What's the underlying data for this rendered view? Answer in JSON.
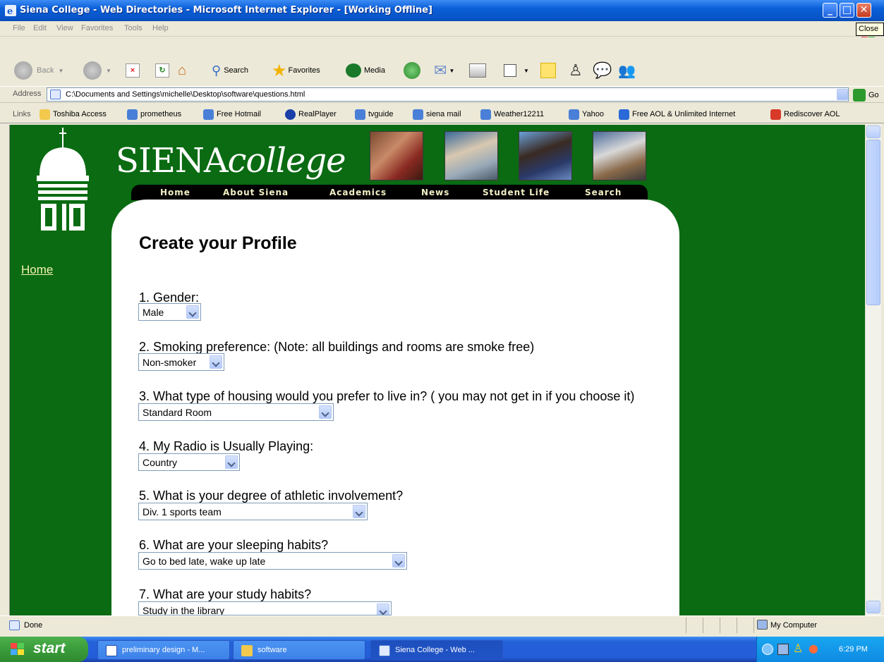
{
  "window": {
    "title": "Siena College - Web Directories - Microsoft Internet Explorer - [Working Offline]",
    "tooltip": "Close"
  },
  "menu": [
    "File",
    "Edit",
    "View",
    "Favorites",
    "Tools",
    "Help"
  ],
  "toolbar": {
    "back": "Back",
    "search": "Search",
    "favorites": "Favorites",
    "media": "Media"
  },
  "address": {
    "label": "Address",
    "url": "C:\\Documents and Settings\\michelle\\Desktop\\software\\questions.html",
    "go": "Go"
  },
  "links": {
    "label": "Links",
    "items": [
      {
        "label": "Toshiba Access",
        "icon": "folder-icon"
      },
      {
        "label": "prometheus",
        "icon": "ie-page-icon"
      },
      {
        "label": "Free Hotmail",
        "icon": "ie-page-icon"
      },
      {
        "label": "RealPlayer",
        "icon": "realplayer-icon"
      },
      {
        "label": "tvguide",
        "icon": "ie-page-icon"
      },
      {
        "label": "siena mail",
        "icon": "ie-page-icon"
      },
      {
        "label": "Weather12211",
        "icon": "ie-page-icon"
      },
      {
        "label": "Yahoo",
        "icon": "ie-page-icon"
      },
      {
        "label": "Free AOL & Unlimited Internet",
        "icon": "aol-icon"
      },
      {
        "label": "Rediscover AOL",
        "icon": "aol-red-icon"
      }
    ]
  },
  "site": {
    "logo_main": "SIENA",
    "logo_italic": "college",
    "nav": [
      "Home",
      "About Siena",
      "Academics",
      "News",
      "Student Life",
      "Search"
    ],
    "side_home": "Home"
  },
  "form": {
    "title": "Create your Profile",
    "questions": [
      {
        "label": "1. Gender:",
        "value": "Male"
      },
      {
        "label": "2. Smoking preference: (Note: all buildings and rooms are smoke free)",
        "value": "Non-smoker"
      },
      {
        "label": "3. What type of housing would you prefer to live in? ( you may not get in if you choose it)",
        "value": "Standard Room"
      },
      {
        "label": "4. My Radio is Usually Playing:",
        "value": "Country"
      },
      {
        "label": "5. What is your degree of athletic involvement?",
        "value": "Div. 1 sports team"
      },
      {
        "label": "6. What are your sleeping habits?",
        "value": "Go to bed late, wake up late"
      },
      {
        "label": "7. What are your study habits?",
        "value": "Study in the library"
      }
    ]
  },
  "status": {
    "text": "Done",
    "zone": "My Computer"
  },
  "taskbar": {
    "start": "start",
    "tasks": [
      "preliminary design - M...",
      "software",
      "Siena College - Web ..."
    ],
    "clock": "6:29 PM"
  }
}
